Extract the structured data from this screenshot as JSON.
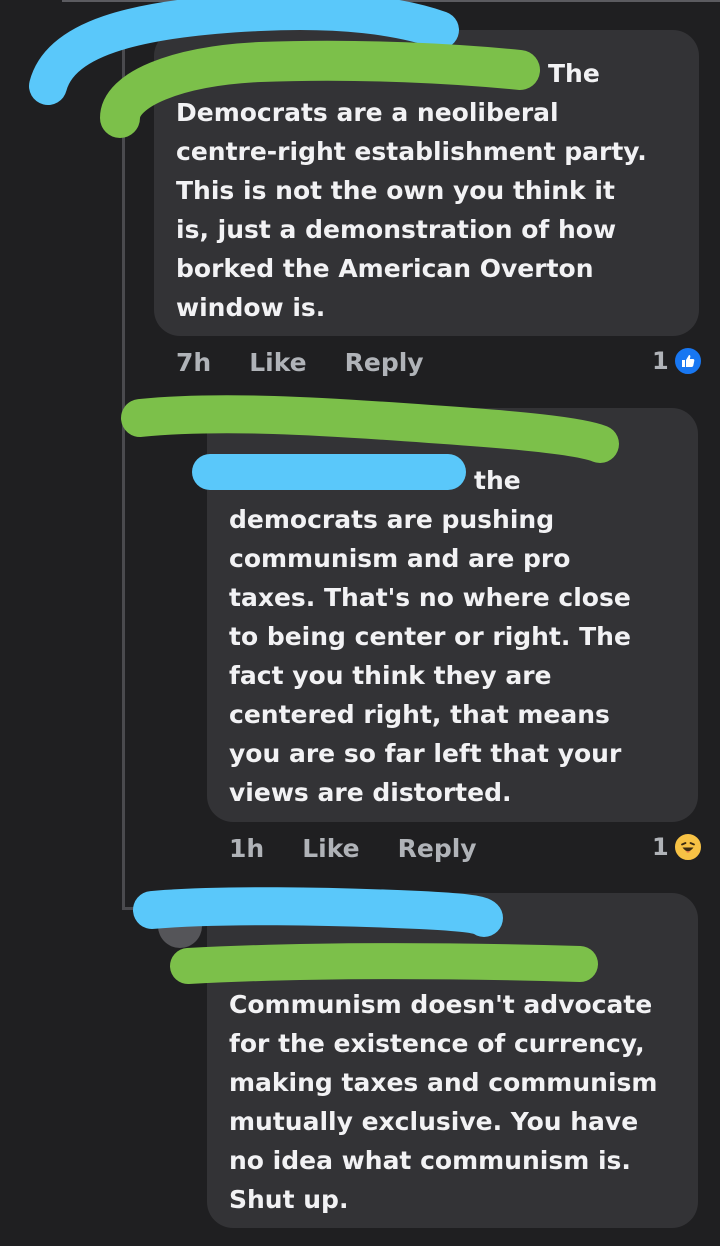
{
  "comments": [
    {
      "lead_word": "The",
      "text": "Democrats are a neoliberal\ncentre-right establishment party.\nThis is not the own you think it\nis, just a demonstration of how\nborked the American Overton\nwindow is.",
      "time": "7h",
      "like_label": "Like",
      "reply_label": "Reply",
      "reaction_count": "1",
      "reaction_icon": "like-icon"
    },
    {
      "lead_word": "the",
      "text": "democrats are pushing\ncommunism and are pro\ntaxes. That's no where close\nto being center or right. The\nfact you think they are\ncentered right, that means\nyou are so far left that your\nviews are distorted.",
      "time": "1h",
      "like_label": "Like",
      "reply_label": "Reply",
      "reaction_count": "1",
      "reaction_icon": "haha-icon"
    },
    {
      "text": "Communism doesn't advocate\nfor the existence of currency,\nmaking taxes and communism\nmutually exclusive. You have\nno idea what communism is.\nShut up."
    }
  ],
  "colors": {
    "background": "#1f1f21",
    "bubble": "#333336",
    "text": "#f2f2f4",
    "meta": "#b0b3b8",
    "like_blue": "#1877f2",
    "redact_blue": "#5ac8fa",
    "redact_green": "#7cc04a"
  }
}
